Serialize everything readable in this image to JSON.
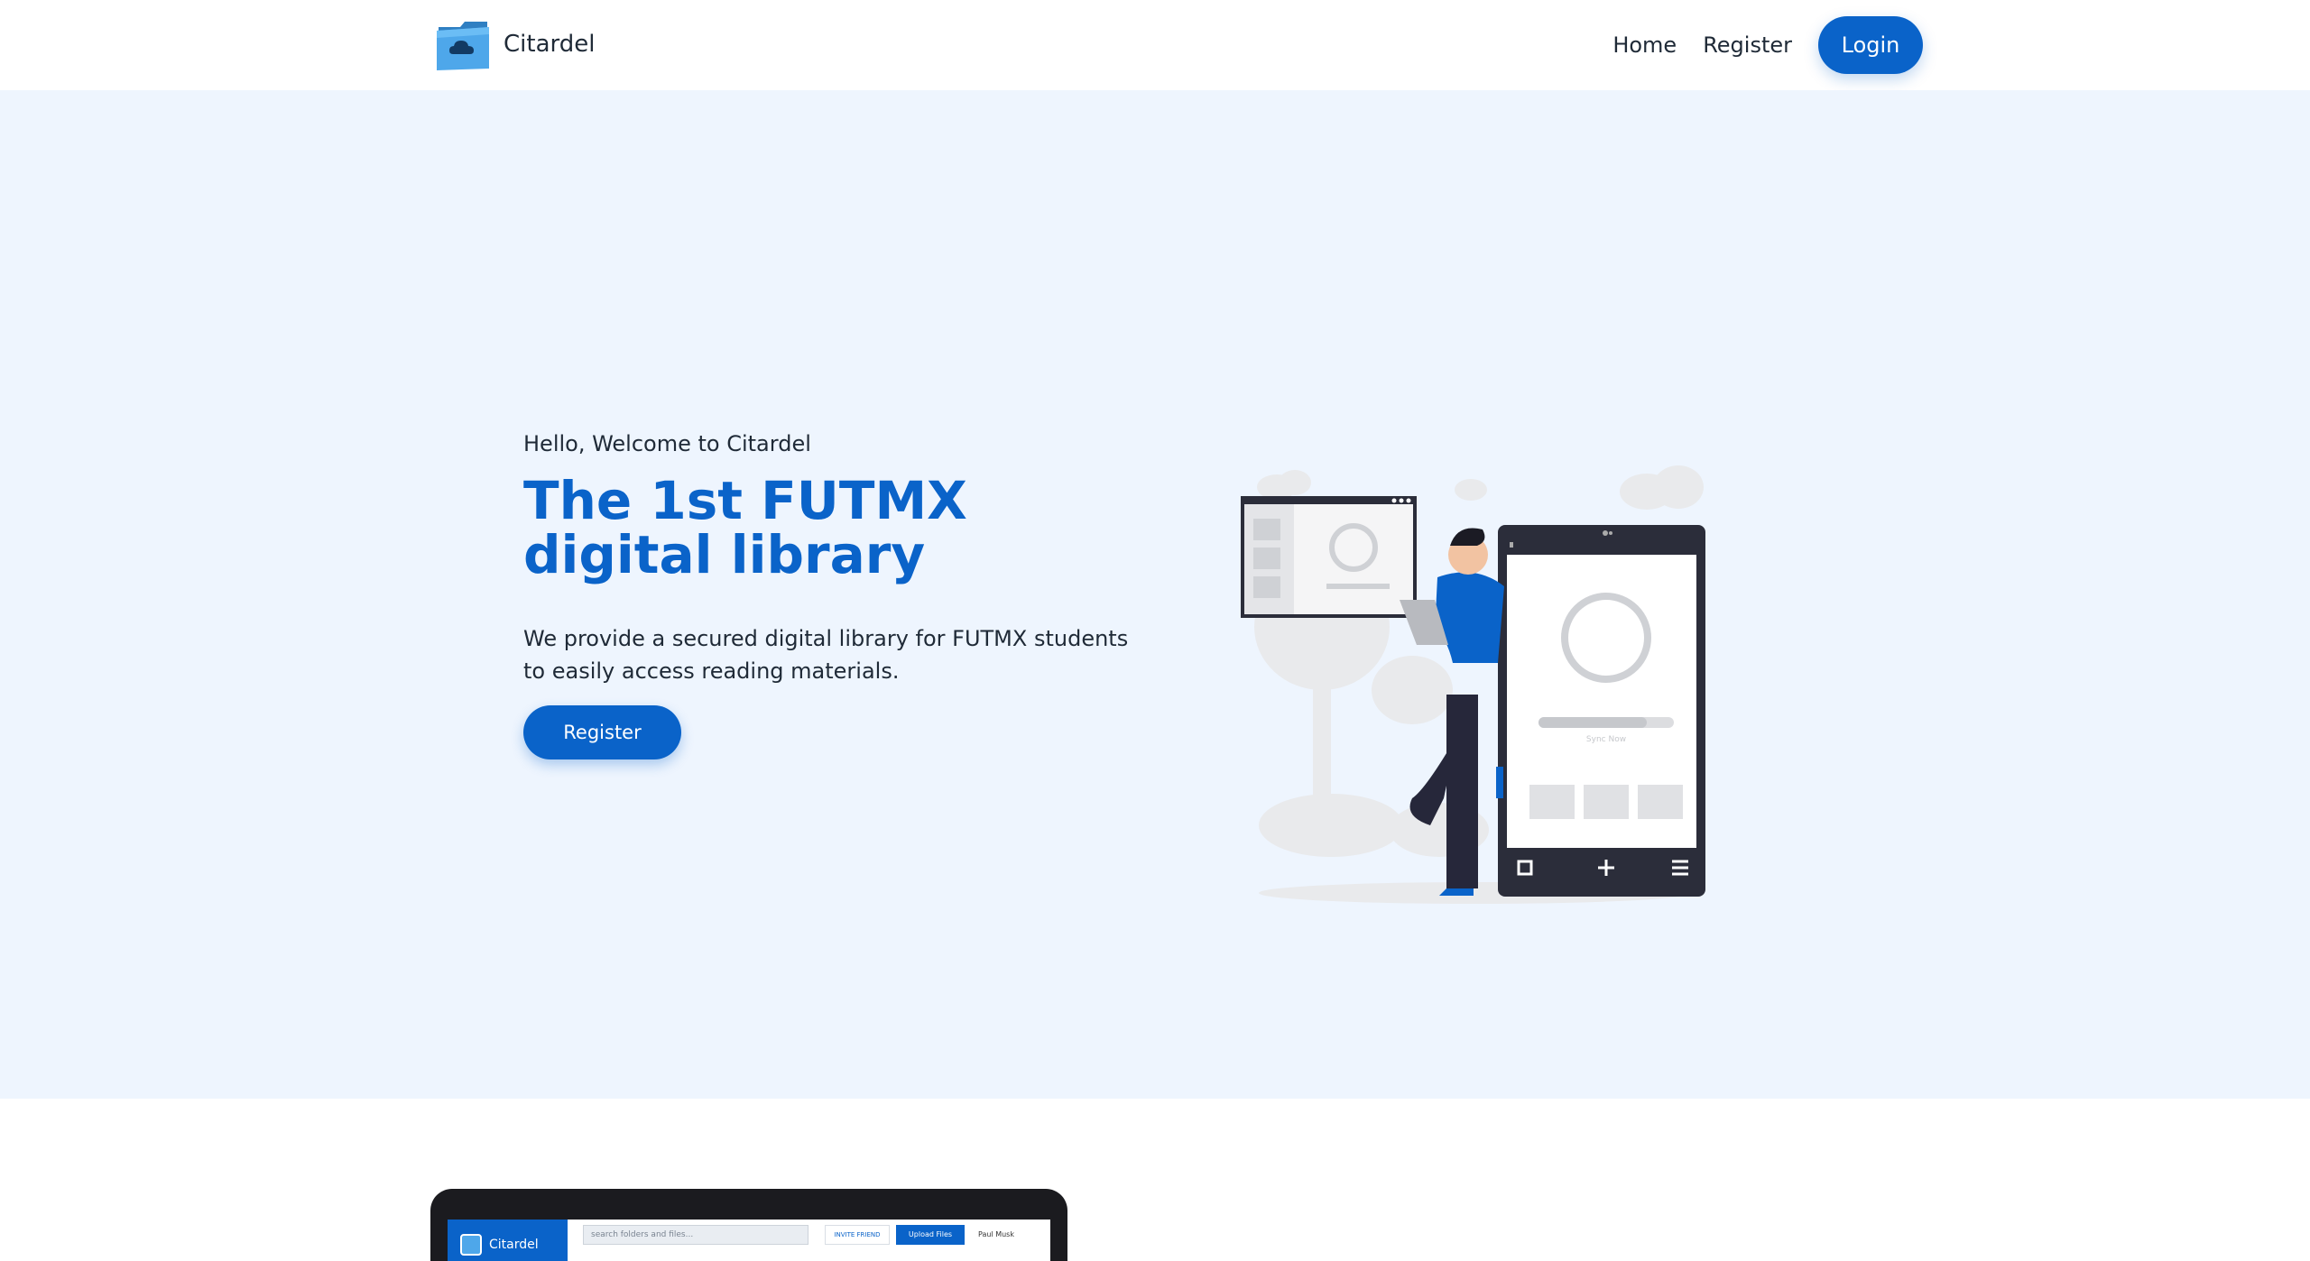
{
  "brand": {
    "name": "Citardel"
  },
  "nav": {
    "links": [
      "Home",
      "Register"
    ],
    "login_label": "Login"
  },
  "hero": {
    "greeting": "Hello, Welcome to Citardel",
    "title": "The 1st FUTMX digital library",
    "description": "We provide a secured digital library for FUTMX students to easily access reading materials.",
    "cta_label": "Register",
    "illustration": {
      "sync_caption": "Sync Now"
    }
  },
  "preview": {
    "brand": "Citardel",
    "search_placeholder": "search folders and files...",
    "invite_label": "INVITE FRIEND",
    "upload_label": "Upload Files",
    "user_name": "Paul Musk"
  },
  "colors": {
    "primary": "#0a63c9",
    "hero_bg": "#eef5fe",
    "text": "#1f2a37"
  },
  "icons": [
    "folder-cloud-icon",
    "refresh-icon",
    "plus-icon",
    "menu-icon",
    "square-icon"
  ]
}
